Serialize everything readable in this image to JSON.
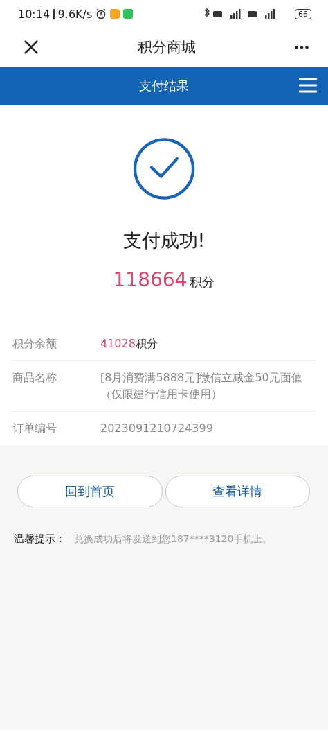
{
  "status_bar": {
    "time": "10:14",
    "speed": "9.6K/s",
    "battery": "66"
  },
  "header": {
    "title": "积分商城"
  },
  "page_bar": {
    "title": "支付结果"
  },
  "result": {
    "message": "支付成功!",
    "points": "118664",
    "points_unit": "积分"
  },
  "details": [
    {
      "label": "积分余额",
      "value": "41028",
      "unit": "积分"
    },
    {
      "label": "商品名称",
      "value": "[8月消费满5888元]微信立减金50元面值（仅限建行信用卡使用）"
    },
    {
      "label": "订单编号",
      "value": "2023091210724399"
    }
  ],
  "buttons": [
    "回到首页",
    "查看详情"
  ],
  "tip": {
    "label": "温馨提示：",
    "text": "兑换成功后将发送到您187****3120手机上。"
  }
}
